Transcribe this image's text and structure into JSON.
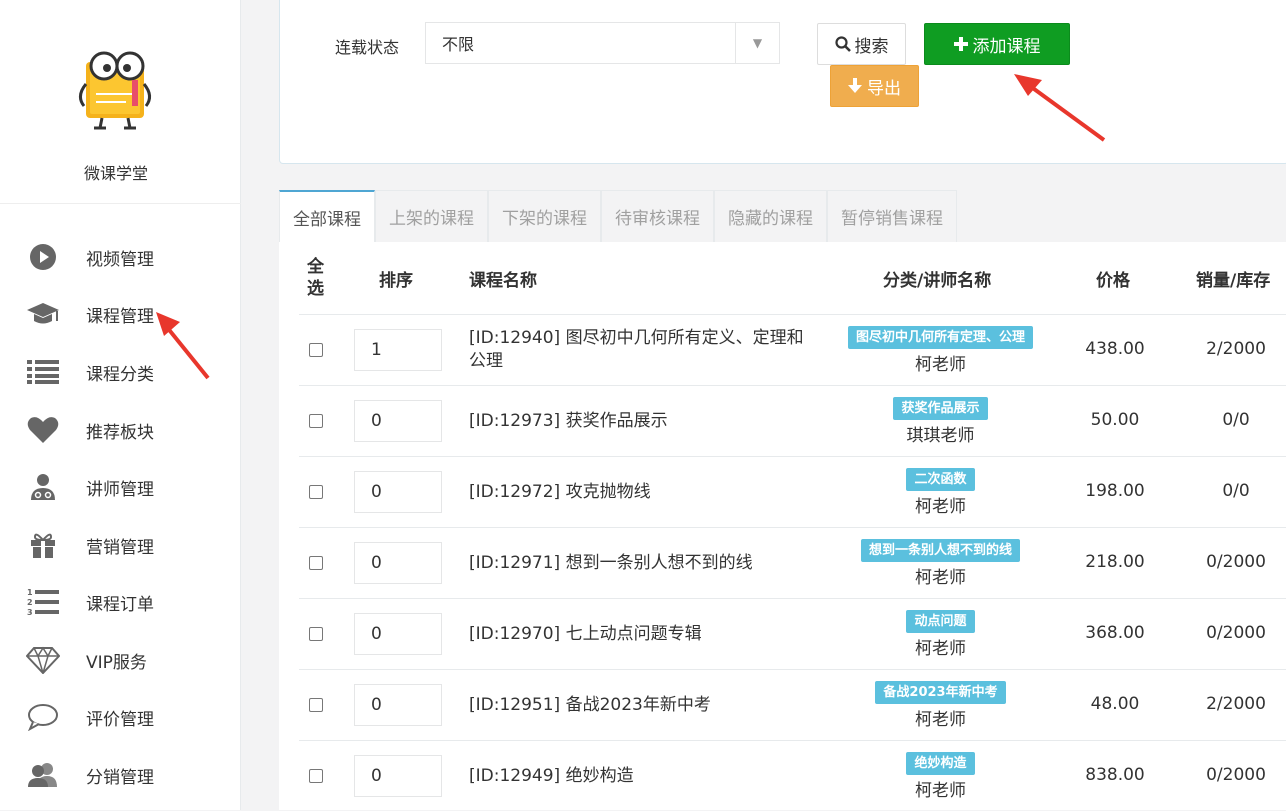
{
  "sidebar": {
    "brand": "微课学堂",
    "items": [
      {
        "label": "视频管理",
        "icon": "play-circle-icon"
      },
      {
        "label": "课程管理",
        "icon": "graduation-cap-icon"
      },
      {
        "label": "课程分类",
        "icon": "list-icon"
      },
      {
        "label": "推荐板块",
        "icon": "heart-icon"
      },
      {
        "label": "讲师管理",
        "icon": "user-md-icon"
      },
      {
        "label": "营销管理",
        "icon": "gift-icon"
      },
      {
        "label": "课程订单",
        "icon": "ordered-list-icon"
      },
      {
        "label": "VIP服务",
        "icon": "diamond-icon"
      },
      {
        "label": "评价管理",
        "icon": "comment-icon"
      },
      {
        "label": "分销管理",
        "icon": "users-icon"
      }
    ]
  },
  "filter": {
    "label": "连载状态",
    "select_value": "不限",
    "search_label": "搜索",
    "add_label": "添加课程",
    "export_label": "导出"
  },
  "tabs": [
    "全部课程",
    "上架的课程",
    "下架的课程",
    "待审核课程",
    "隐藏的课程",
    "暂停销售课程"
  ],
  "table": {
    "headers": {
      "select": "全选",
      "sort": "排序",
      "name": "课程名称",
      "category": "分类/讲师名称",
      "price": "价格",
      "stock": "销量/库存"
    },
    "rows": [
      {
        "sort": "1",
        "name": "[ID:12940] 图尽初中几何所有定义、定理和公理",
        "category": "图尽初中几何所有定理、公理",
        "teacher": "柯老师",
        "price": "438.00",
        "stock": "2/2000"
      },
      {
        "sort": "0",
        "name": "[ID:12973] 获奖作品展示",
        "category": "获奖作品展示",
        "teacher": "琪琪老师",
        "price": "50.00",
        "stock": "0/0"
      },
      {
        "sort": "0",
        "name": "[ID:12972] 攻克抛物线",
        "category": "二次函数",
        "teacher": "柯老师",
        "price": "198.00",
        "stock": "0/0"
      },
      {
        "sort": "0",
        "name": "[ID:12971] 想到一条别人想不到的线",
        "category": "想到一条别人想不到的线",
        "teacher": "柯老师",
        "price": "218.00",
        "stock": "0/2000"
      },
      {
        "sort": "0",
        "name": "[ID:12970] 七上动点问题专辑",
        "category": "动点问题",
        "teacher": "柯老师",
        "price": "368.00",
        "stock": "0/2000"
      },
      {
        "sort": "0",
        "name": "[ID:12951] 备战2023年新中考",
        "category": "备战2023年新中考",
        "teacher": "柯老师",
        "price": "48.00",
        "stock": "2/2000"
      },
      {
        "sort": "0",
        "name": "[ID:12949] 绝妙构造",
        "category": "绝妙构造",
        "teacher": "柯老师",
        "price": "838.00",
        "stock": "0/2000"
      }
    ]
  },
  "colors": {
    "add_button": "#0f9d22",
    "export_button": "#f0ad4e",
    "badge": "#5bc0de",
    "tab_active_border": "#4fa6d3",
    "arrow": "#e8372c"
  }
}
